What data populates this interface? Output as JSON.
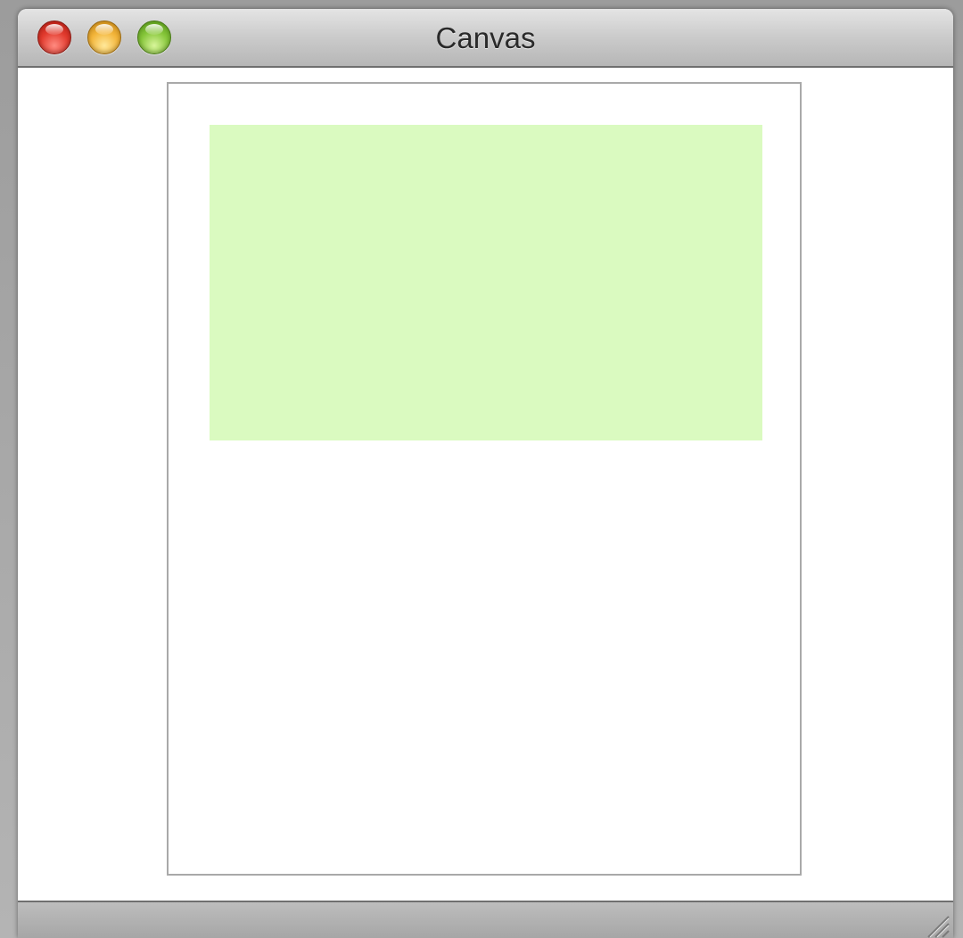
{
  "window": {
    "title": "Canvas"
  },
  "titlebar_buttons": {
    "close": "close-button",
    "minimize": "minimize-button",
    "zoom": "zoom-button"
  },
  "canvas": {
    "page_color": "#ffffff",
    "page_border_color": "#a9a9a9",
    "shape": {
      "type": "rectangle",
      "fill": "#dafac0"
    }
  },
  "colors": {
    "close": "#e23b2e",
    "minimize": "#f3b53a",
    "zoom": "#86c63a"
  }
}
